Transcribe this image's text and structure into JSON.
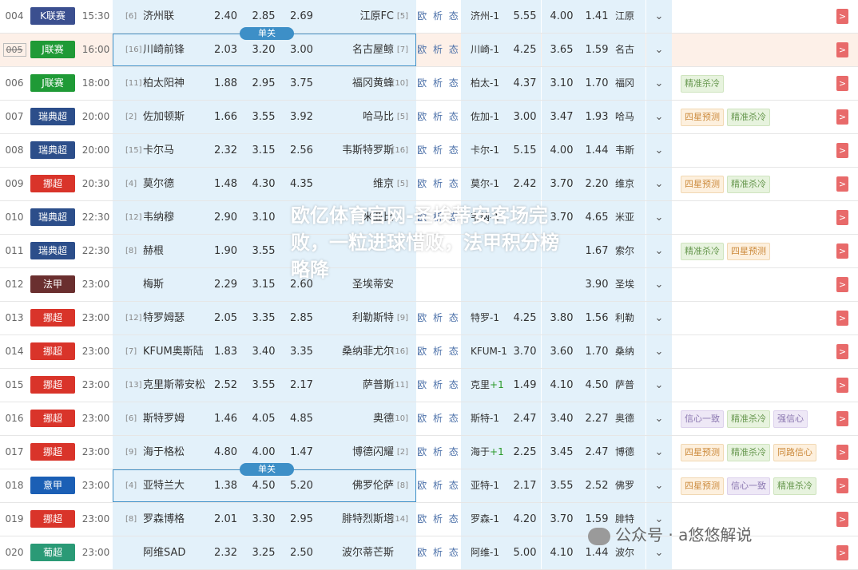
{
  "colors": {
    "k": "#3b4f8f",
    "j": "#1f9a36",
    "sw": "#2c4e8a",
    "no": "#d9342a",
    "fr": "#6a2f2f",
    "it": "#1b5fb5",
    "pt": "#2a9a76"
  },
  "rows": [
    {
      "num": "004",
      "league": "K联赛",
      "lc": "k",
      "time": "15:30",
      "hr": "[6]",
      "home": "济州联",
      "o_h": "2.40",
      "o_d": "2.85",
      "o_a": "2.69",
      "away": "江原FC",
      "ar": "[5]",
      "links": "欧 析 态",
      "hc": "济州-1",
      "plus": "",
      "v1": "5.55",
      "v2": "4.00",
      "v3": "1.41",
      "short": "江原",
      "tags": [],
      "hl": false
    },
    {
      "num": "005",
      "league": "J联赛",
      "lc": "j",
      "time": "16:00",
      "hr": "[16]",
      "home": "川崎前锋",
      "o_h": "2.03",
      "o_d": "3.20",
      "o_a": "3.00",
      "away": "名古屋鲸",
      "ar": "[7]",
      "links": "欧 析 态",
      "hc": "川崎-1",
      "plus": "",
      "v1": "4.25",
      "v2": "3.65",
      "v3": "1.59",
      "short": "名古",
      "tags": [],
      "hl": true,
      "sel": true
    },
    {
      "num": "006",
      "league": "J联赛",
      "lc": "j",
      "time": "18:00",
      "hr": "[11]",
      "home": "柏太阳神",
      "o_h": "1.88",
      "o_d": "2.95",
      "o_a": "3.75",
      "away": "福冈黄蜂",
      "ar": "[10]",
      "links": "欧 析 态",
      "hc": "柏太-1",
      "plus": "",
      "v1": "4.37",
      "v2": "3.10",
      "v3": "1.70",
      "short": "福冈",
      "tags": [
        {
          "t": "精准杀冷",
          "c": "g"
        }
      ],
      "hl": false
    },
    {
      "num": "007",
      "league": "瑞典超",
      "lc": "sw",
      "time": "20:00",
      "hr": "[2]",
      "home": "佐加顿斯",
      "o_h": "1.66",
      "o_d": "3.55",
      "o_a": "3.92",
      "away": "哈马比",
      "ar": "[5]",
      "links": "欧 析 态",
      "hc": "佐加-1",
      "plus": "",
      "v1": "3.00",
      "v2": "3.47",
      "v3": "1.93",
      "short": "哈马",
      "tags": [
        {
          "t": "四星预测",
          "c": "o"
        },
        {
          "t": "精准杀冷",
          "c": "g"
        }
      ],
      "hl": false
    },
    {
      "num": "008",
      "league": "瑞典超",
      "lc": "sw",
      "time": "20:00",
      "hr": "[15]",
      "home": "卡尔马",
      "o_h": "2.32",
      "o_d": "3.15",
      "o_a": "2.56",
      "away": "韦斯特罗斯",
      "ar": "[16]",
      "links": "欧 析 态",
      "hc": "卡尔-1",
      "plus": "",
      "v1": "5.15",
      "v2": "4.00",
      "v3": "1.44",
      "short": "韦斯",
      "tags": [],
      "hl": false
    },
    {
      "num": "009",
      "league": "挪超",
      "lc": "no",
      "time": "20:30",
      "hr": "[4]",
      "home": "莫尔德",
      "o_h": "1.48",
      "o_d": "4.30",
      "o_a": "4.35",
      "away": "维京",
      "ar": "[5]",
      "links": "欧 析 态",
      "hc": "莫尔-1",
      "plus": "",
      "v1": "2.42",
      "v2": "3.70",
      "v3": "2.20",
      "short": "维京",
      "tags": [
        {
          "t": "四星预测",
          "c": "o"
        },
        {
          "t": "精准杀冷",
          "c": "g"
        }
      ],
      "hl": false
    },
    {
      "num": "010",
      "league": "瑞典超",
      "lc": "sw",
      "time": "22:30",
      "hr": "[12]",
      "home": "韦纳穆",
      "o_h": "2.90",
      "o_d": "3.10",
      "o_a": "",
      "away": "米亚比",
      "ar": "",
      "links": "欧 析 态",
      "hc": "韦纳-1",
      "plus": "",
      "v1": "",
      "v2": "3.70",
      "v3": "4.65",
      "short": "米亚",
      "tags": [],
      "hl": false
    },
    {
      "num": "011",
      "league": "瑞典超",
      "lc": "sw",
      "time": "22:30",
      "hr": "[8]",
      "home": "赫根",
      "o_h": "1.90",
      "o_d": "3.55",
      "o_a": "",
      "away": "",
      "ar": "",
      "links": "",
      "hc": "",
      "plus": "",
      "v1": "",
      "v2": "",
      "v3": "1.67",
      "short": "索尔",
      "tags": [
        {
          "t": "精准杀冷",
          "c": "g"
        },
        {
          "t": "四星预测",
          "c": "o"
        }
      ],
      "hl": false
    },
    {
      "num": "012",
      "league": "法甲",
      "lc": "fr",
      "time": "23:00",
      "hr": "",
      "home": "梅斯",
      "o_h": "2.29",
      "o_d": "3.15",
      "o_a": "2.60",
      "away": "圣埃蒂安",
      "ar": "",
      "links": "",
      "hc": "",
      "plus": "",
      "v1": "",
      "v2": "",
      "v3": "3.90",
      "short": "圣埃",
      "tags": [],
      "hl": false
    },
    {
      "num": "013",
      "league": "挪超",
      "lc": "no",
      "time": "23:00",
      "hr": "[12]",
      "home": "特罗姆瑟",
      "o_h": "2.05",
      "o_d": "3.35",
      "o_a": "2.85",
      "away": "利勒斯特",
      "ar": "[9]",
      "links": "欧 析 态",
      "hc": "特罗-1",
      "plus": "",
      "v1": "4.25",
      "v2": "3.80",
      "v3": "1.56",
      "short": "利勒",
      "tags": [],
      "hl": false
    },
    {
      "num": "014",
      "league": "挪超",
      "lc": "no",
      "time": "23:00",
      "hr": "[7]",
      "home": "KFUM奥斯陆",
      "o_h": "1.83",
      "o_d": "3.40",
      "o_a": "3.35",
      "away": "桑纳菲尤尔",
      "ar": "[16]",
      "links": "欧 析 态",
      "hc": "KFUM-1",
      "plus": "",
      "v1": "3.70",
      "v2": "3.60",
      "v3": "1.70",
      "short": "桑纳",
      "tags": [],
      "hl": false
    },
    {
      "num": "015",
      "league": "挪超",
      "lc": "no",
      "time": "23:00",
      "hr": "[13]",
      "home": "克里斯蒂安松",
      "o_h": "2.52",
      "o_d": "3.55",
      "o_a": "2.17",
      "away": "萨普斯",
      "ar": "[11]",
      "links": "欧 析 态",
      "hc": "克里",
      "plus": "+1",
      "v1": "1.49",
      "v2": "4.10",
      "v3": "4.50",
      "short": "萨普",
      "tags": [],
      "hl": false
    },
    {
      "num": "016",
      "league": "挪超",
      "lc": "no",
      "time": "23:00",
      "hr": "[6]",
      "home": "斯特罗姆",
      "o_h": "1.46",
      "o_d": "4.05",
      "o_a": "4.85",
      "away": "奥德",
      "ar": "[10]",
      "links": "欧 析 态",
      "hc": "斯特-1",
      "plus": "",
      "v1": "2.47",
      "v2": "3.40",
      "v3": "2.27",
      "short": "奥德",
      "tags": [
        {
          "t": "信心一致",
          "c": "p"
        },
        {
          "t": "精准杀冷",
          "c": "g"
        },
        {
          "t": "强信心",
          "c": "p"
        }
      ],
      "hl": false
    },
    {
      "num": "017",
      "league": "挪超",
      "lc": "no",
      "time": "23:00",
      "hr": "[9]",
      "home": "海于格松",
      "o_h": "4.80",
      "o_d": "4.00",
      "o_a": "1.47",
      "away": "博德闪耀",
      "ar": "[2]",
      "links": "欧 析 态",
      "hc": "海于",
      "plus": "+1",
      "v1": "2.25",
      "v2": "3.45",
      "v3": "2.47",
      "short": "博德",
      "tags": [
        {
          "t": "四星预测",
          "c": "o"
        },
        {
          "t": "精准杀冷",
          "c": "g"
        },
        {
          "t": "同路信心",
          "c": "o"
        }
      ],
      "hl": false
    },
    {
      "num": "018",
      "league": "意甲",
      "lc": "it",
      "time": "23:00",
      "hr": "[4]",
      "home": "亚特兰大",
      "o_h": "1.38",
      "o_d": "4.50",
      "o_a": "5.20",
      "away": "佛罗伦萨",
      "ar": "[8]",
      "links": "欧 析 态",
      "hc": "亚特-1",
      "plus": "",
      "v1": "2.17",
      "v2": "3.55",
      "v3": "2.52",
      "short": "佛罗",
      "tags": [
        {
          "t": "四星预测",
          "c": "o"
        },
        {
          "t": "信心一致",
          "c": "p"
        },
        {
          "t": "精准杀冷",
          "c": "g"
        }
      ],
      "hl": false,
      "sel": true
    },
    {
      "num": "019",
      "league": "挪超",
      "lc": "no",
      "time": "23:00",
      "hr": "[8]",
      "home": "罗森博格",
      "o_h": "2.01",
      "o_d": "3.30",
      "o_a": "2.95",
      "away": "腓特烈斯塔",
      "ar": "[14]",
      "links": "欧 析 态",
      "hc": "罗森-1",
      "plus": "",
      "v1": "4.20",
      "v2": "3.70",
      "v3": "1.59",
      "short": "腓特",
      "tags": [],
      "hl": false
    },
    {
      "num": "020",
      "league": "葡超",
      "lc": "pt",
      "time": "23:00",
      "hr": "",
      "home": "阿维SAD",
      "o_h": "2.32",
      "o_d": "3.25",
      "o_a": "2.50",
      "away": "波尔蒂芒斯",
      "ar": "",
      "links": "欧 析 态",
      "hc": "阿维-1",
      "plus": "",
      "v1": "5.00",
      "v2": "4.10",
      "v3": "1.44",
      "short": "波尔",
      "tags": [],
      "hl": false
    }
  ],
  "single_label": "单关",
  "chevron": "⌄",
  "arrow": ">",
  "overlay_text": "欧亿体育官网-圣埃蒂安客场完败，一粒进球惜败，法甲积分榜略降",
  "watermark": "公众号 · a悠悠解说"
}
